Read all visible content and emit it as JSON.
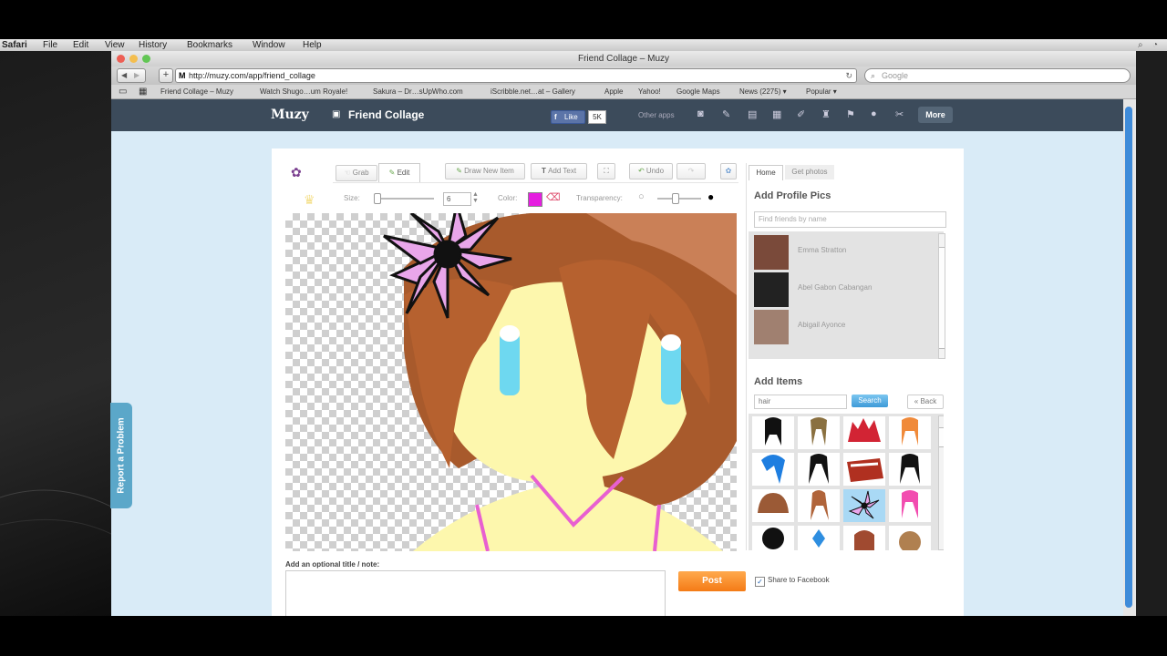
{
  "menubar": {
    "items": [
      "Safari",
      "File",
      "Edit",
      "View",
      "History",
      "Bookmarks",
      "Window",
      "Help"
    ]
  },
  "browser": {
    "title": "Friend Collage – Muzy",
    "url": "http://muzy.com/app/friend_collage",
    "search_placeholder": "Google",
    "bookmarks": [
      "Friend Collage – Muzy",
      "Watch Shugo…um Royale!",
      "Sakura – Dr…sUpWho.com",
      "iScribble.net…at – Gallery",
      "Apple",
      "Yahoo!",
      "Google Maps",
      "News (2275) ▾",
      "Popular ▾"
    ]
  },
  "muzy": {
    "logo": "Muzy",
    "app_title": "Friend Collage",
    "like_label": "Like",
    "like_count": "5K",
    "other_apps": "Other apps",
    "more_label": "More"
  },
  "editor": {
    "tab_grab": "Grab",
    "tab_edit": "Edit",
    "draw_new_item": "Draw New Item",
    "add_text": "Add Text",
    "undo": "Undo",
    "size_label": "Size:",
    "size_value": "6",
    "color_label": "Color:",
    "transparency_label": "Transparency:",
    "brush_color": "#e51ee0",
    "note_label": "Add an optional title / note:",
    "post_label": "Post",
    "share_label": "Share to Facebook",
    "share_checked": true
  },
  "side": {
    "tab_home": "Home",
    "tab_get_photos": "Get photos",
    "profile_heading": "Add Profile Pics",
    "find_placeholder": "Find friends by name",
    "friends": [
      "Emma Stratton",
      "Abel Gabon Cabangan",
      "Abigail Ayonce"
    ],
    "items_heading": "Add Items",
    "items_search_value": "hair",
    "search_label": "Search",
    "back_label": "« Back"
  },
  "report_label": "Report a Problem"
}
